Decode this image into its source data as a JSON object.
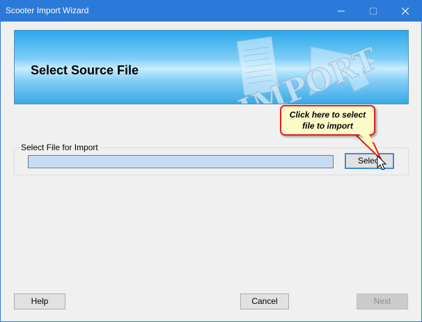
{
  "window": {
    "title": "Scooter Import Wizard",
    "accent_color": "#2b79d8",
    "controls": [
      "minimize-icon",
      "maximize-icon",
      "close-icon"
    ]
  },
  "banner": {
    "title": "Select Source File",
    "art_text": "IMPORT",
    "art_icons": [
      "document-icon",
      "arrow-icon"
    ]
  },
  "file_group": {
    "label": "Select File for Import",
    "file_value": "",
    "select_label": "Select"
  },
  "callout": {
    "line1": "Click here to select",
    "line2": "file to import",
    "border_color": "#e12020"
  },
  "footer": {
    "help_label": "Help",
    "cancel_label": "Cancel",
    "next_label": "Next",
    "next_enabled": false
  }
}
